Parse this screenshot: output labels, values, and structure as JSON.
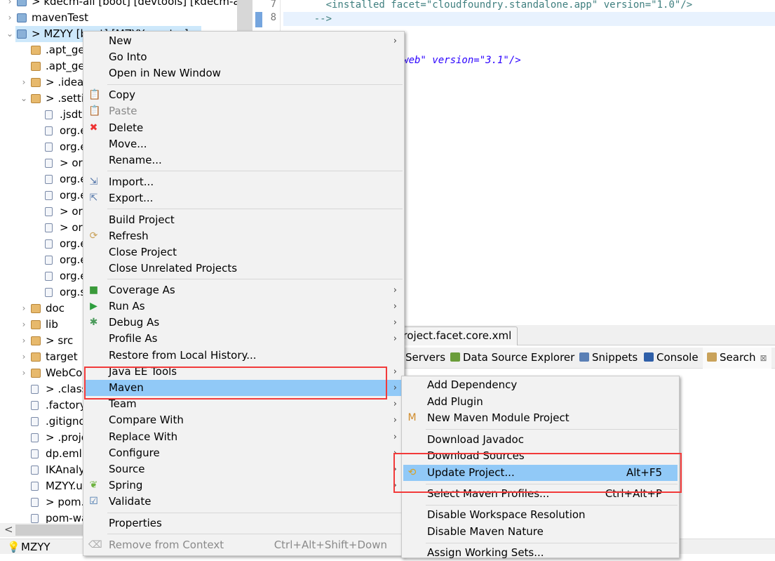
{
  "tree": {
    "items": [
      {
        "label": "> kdecm-all [boot] [devtools] [kdecm-all",
        "icon": "project",
        "indent": 0,
        "chev": ">"
      },
      {
        "label": "mavenTest",
        "icon": "project",
        "indent": 0,
        "chev": ">"
      },
      {
        "label": "> MZYY [boot] [MZYY-master]",
        "icon": "project",
        "indent": 0,
        "chev": "v",
        "selected": true
      },
      {
        "label": ".apt_generated",
        "icon": "folder",
        "indent": 1
      },
      {
        "label": ".apt_generated_tests",
        "icon": "folder",
        "indent": 1
      },
      {
        "label": "> .idea",
        "icon": "folder",
        "indent": 1,
        "chev": ">"
      },
      {
        "label": "> .settings",
        "icon": "folder",
        "indent": 1,
        "chev": "v"
      },
      {
        "label": ".jsdtscope",
        "icon": "file",
        "indent": 2
      },
      {
        "label": "org.eclipse",
        "icon": "file",
        "indent": 2
      },
      {
        "label": "org.eclipse",
        "icon": "file",
        "indent": 2
      },
      {
        "label": "> org.eclipse",
        "icon": "file",
        "indent": 2
      },
      {
        "label": "org.eclipse",
        "icon": "file",
        "indent": 2
      },
      {
        "label": "org.eclipse",
        "icon": "file",
        "indent": 2
      },
      {
        "label": "> org.eclipse",
        "icon": "file",
        "indent": 2
      },
      {
        "label": "> org.eclipse",
        "icon": "file",
        "indent": 2
      },
      {
        "label": "org.eclipse",
        "icon": "file",
        "indent": 2
      },
      {
        "label": "org.eclipse",
        "icon": "file",
        "indent": 2
      },
      {
        "label": "org.eclipse",
        "icon": "file",
        "indent": 2
      },
      {
        "label": "org.springframework",
        "icon": "file",
        "indent": 2
      },
      {
        "label": "doc",
        "icon": "folder",
        "indent": 1,
        "chev": ">"
      },
      {
        "label": "lib",
        "icon": "folder",
        "indent": 1,
        "chev": ">"
      },
      {
        "label": "> src",
        "icon": "folder",
        "indent": 1,
        "chev": ">"
      },
      {
        "label": "target",
        "icon": "folder",
        "indent": 1,
        "chev": ">"
      },
      {
        "label": "WebContent",
        "icon": "folder",
        "indent": 1,
        "chev": ">"
      },
      {
        "label": "> .classpath",
        "icon": "file",
        "indent": 1
      },
      {
        "label": ".factorypath",
        "icon": "file",
        "indent": 1
      },
      {
        "label": ".gitignore",
        "icon": "file",
        "indent": 1
      },
      {
        "label": "> .project",
        "icon": "file",
        "indent": 1
      },
      {
        "label": "dp.eml",
        "icon": "file",
        "indent": 1
      },
      {
        "label": "IKAnalyzer.cfg.xml",
        "icon": "file",
        "indent": 1
      },
      {
        "label": "MZYY.userlibraries",
        "icon": "file",
        "indent": 1
      },
      {
        "label": "> pom.xml",
        "icon": "file",
        "indent": 1
      },
      {
        "label": "pom-war.xml",
        "icon": "file",
        "indent": 1
      }
    ],
    "scroll_left_arrow": "<"
  },
  "status": {
    "text": "MZYY",
    "icon": "lightbulb-icon"
  },
  "editor": {
    "lines": [
      {
        "num": "7",
        "text": "      <installed facet=\"cloudfoundry.standalone.app\" version=\"1.0\"/>"
      },
      {
        "num": "8",
        "text": "    -->",
        "highlighted": true
      }
    ],
    "visible_fragment": "\"jst.web\" version=\"3.1\"/>",
    "tab": "project.facet.core.xml"
  },
  "views": [
    {
      "label": "Servers",
      "icon": "servers-icon"
    },
    {
      "label": "Data Source Explorer",
      "icon": "data-source-icon"
    },
    {
      "label": "Snippets",
      "icon": "snippets-icon"
    },
    {
      "label": "Console",
      "icon": "console-icon"
    },
    {
      "label": "Search",
      "icon": "search-icon",
      "active": true,
      "close": "⊠"
    }
  ],
  "context_menu": {
    "items": [
      {
        "label": "New",
        "submenu": true
      },
      {
        "label": "Go Into"
      },
      {
        "label": "Open in New Window"
      },
      {
        "sep": true
      },
      {
        "label": "Copy",
        "icon": "copy"
      },
      {
        "label": "Paste",
        "icon": "paste",
        "disabled": true
      },
      {
        "label": "Delete",
        "icon": "delete"
      },
      {
        "label": "Move..."
      },
      {
        "label": "Rename..."
      },
      {
        "sep": true
      },
      {
        "label": "Import...",
        "icon": "import"
      },
      {
        "label": "Export...",
        "icon": "export"
      },
      {
        "sep": true
      },
      {
        "label": "Build Project"
      },
      {
        "label": "Refresh",
        "icon": "refresh"
      },
      {
        "label": "Close Project"
      },
      {
        "label": "Close Unrelated Projects"
      },
      {
        "sep": true
      },
      {
        "label": "Coverage As",
        "icon": "coverage",
        "submenu": true
      },
      {
        "label": "Run As",
        "icon": "run",
        "submenu": true
      },
      {
        "label": "Debug As",
        "icon": "debug",
        "submenu": true
      },
      {
        "label": "Profile As",
        "submenu": true
      },
      {
        "label": "Restore from Local History..."
      },
      {
        "label": "Java EE Tools",
        "submenu": true
      },
      {
        "label": "Maven",
        "submenu": true,
        "hover": true
      },
      {
        "label": "Team",
        "submenu": true
      },
      {
        "label": "Compare With",
        "submenu": true
      },
      {
        "label": "Replace With",
        "submenu": true
      },
      {
        "label": "Configure",
        "submenu": true
      },
      {
        "label": "Source",
        "submenu": true
      },
      {
        "label": "Spring",
        "icon": "spring",
        "submenu": true
      },
      {
        "label": "Validate",
        "icon": "validate"
      },
      {
        "sep": true
      },
      {
        "label": "Properties"
      },
      {
        "sep": true
      },
      {
        "label": "Remove from Context",
        "icon": "remove-context",
        "disabled": true,
        "shortcut": "Ctrl+Alt+Shift+Down"
      }
    ]
  },
  "maven_submenu": {
    "items": [
      {
        "label": "Add Dependency"
      },
      {
        "label": "Add Plugin"
      },
      {
        "label": "New Maven Module Project",
        "icon": "maven-module"
      },
      {
        "sep": true
      },
      {
        "label": "Download Javadoc"
      },
      {
        "label": "Download Sources"
      },
      {
        "label": "Update Project...",
        "icon": "update-project",
        "shortcut": "Alt+F5",
        "hover": true
      },
      {
        "sep": true
      },
      {
        "label": "Select Maven Profiles...",
        "shortcut": "Ctrl+Alt+P"
      },
      {
        "sep": true
      },
      {
        "label": "Disable Workspace Resolution"
      },
      {
        "label": "Disable Maven Nature"
      },
      {
        "sep": true
      },
      {
        "label": "Assign Working Sets..."
      }
    ]
  },
  "colors": {
    "highlight": "#91c9f7",
    "annotation_box": "#f23a3a",
    "selection": "#cde8fb"
  }
}
